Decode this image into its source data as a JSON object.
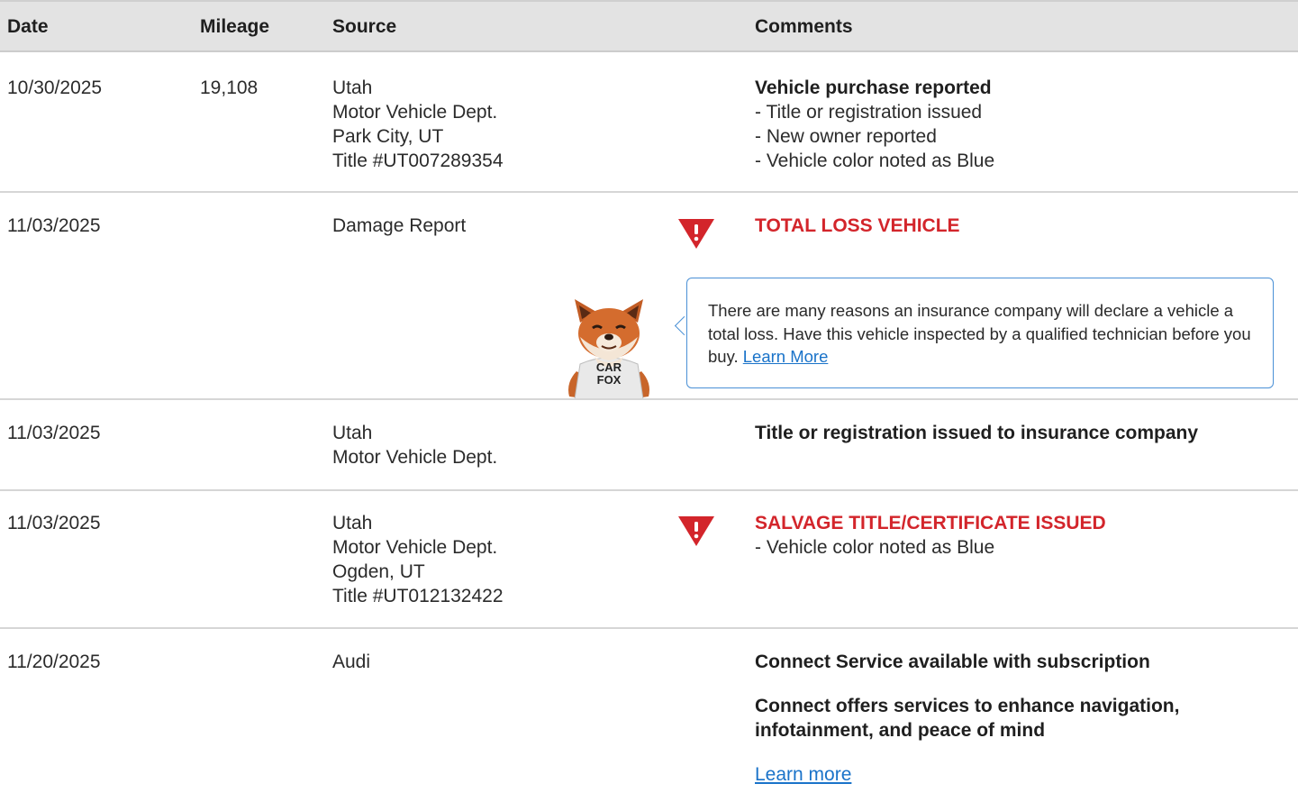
{
  "header": {
    "date": "Date",
    "mileage": "Mileage",
    "source": "Source",
    "comments": "Comments"
  },
  "rows": [
    {
      "date": "10/30/2025",
      "mileage": "19,108",
      "source": [
        "Utah",
        "Motor Vehicle Dept.",
        "Park City, UT",
        "Title #UT007289354"
      ],
      "title": "Vehicle purchase reported",
      "details": [
        "- Title or registration issued",
        "- New owner reported",
        "- Vehicle color noted as Blue"
      ]
    },
    {
      "date": "11/03/2025",
      "source": [
        "Damage Report"
      ],
      "alert": "TOTAL LOSS VEHICLE",
      "tip": {
        "text": "There are many reasons an insurance company will declare a vehicle a total loss. Have this vehicle inspected by a qualified technician before you buy.",
        "link": "Learn More"
      },
      "mascot_shirt": [
        "CAR",
        "FOX"
      ]
    },
    {
      "date": "11/03/2025",
      "source": [
        "Utah",
        "Motor Vehicle Dept."
      ],
      "title": "Title or registration issued to insurance company"
    },
    {
      "date": "11/03/2025",
      "source": [
        "Utah",
        "Motor Vehicle Dept.",
        "Ogden, UT",
        "Title #UT012132422"
      ],
      "alert": "SALVAGE TITLE/CERTIFICATE ISSUED",
      "details": [
        "- Vehicle color noted as Blue"
      ]
    },
    {
      "date": "11/20/2025",
      "source": [
        "Audi"
      ],
      "title": "Connect Service available with subscription",
      "subtitle_lines": [
        "Connect offers services to enhance navigation,",
        "infotainment, and peace of mind"
      ],
      "link": "Learn more"
    }
  ],
  "colors": {
    "alert": "#d3252b",
    "link": "#1a73c9",
    "tip_border": "#4a90d6",
    "header_bg": "#e3e3e3"
  },
  "icons": {
    "warning": "warning-triangle-icon",
    "mascot": "carfox-mascot-icon"
  }
}
